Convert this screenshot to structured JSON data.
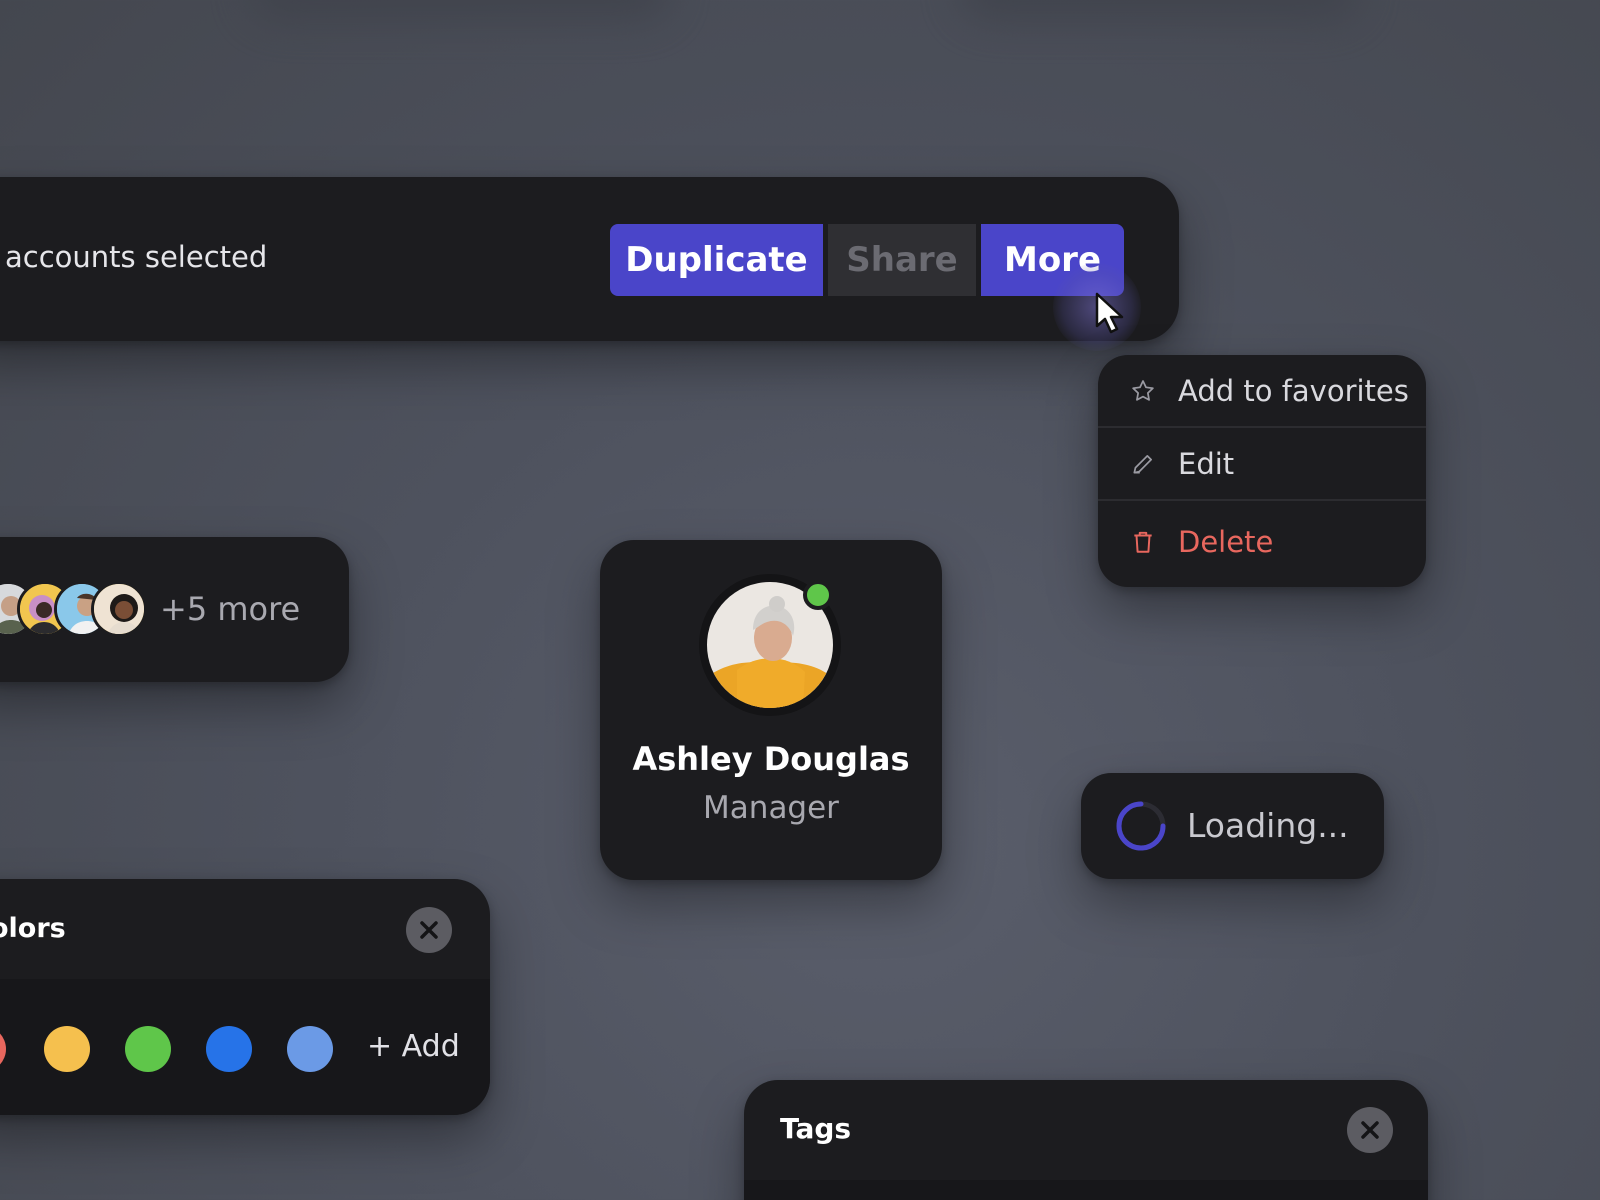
{
  "toolbar": {
    "selection_text": "accounts selected",
    "buttons": {
      "duplicate": "Duplicate",
      "share": "Share",
      "more": "More"
    }
  },
  "menu": {
    "items": [
      {
        "label": "Add to favorites",
        "icon": "star-icon"
      },
      {
        "label": "Edit",
        "icon": "pencil-icon"
      },
      {
        "label": "Delete",
        "icon": "trash-icon"
      }
    ]
  },
  "avatar_group": {
    "more_text": "+5 more"
  },
  "profile": {
    "name": "Ashley Douglas",
    "role": "Manager",
    "status_color": "#5fc64a"
  },
  "loading": {
    "text": "Loading..."
  },
  "colors_panel": {
    "title": "olors",
    "swatches": [
      "#e8675e",
      "#f5c04e",
      "#5fc64a",
      "#2673e8",
      "#6b9ae6"
    ],
    "add_label": "+ Add"
  },
  "tags_panel": {
    "title": "Tags"
  },
  "theme": {
    "accent": "#4a45c9",
    "danger": "#e8675e"
  }
}
